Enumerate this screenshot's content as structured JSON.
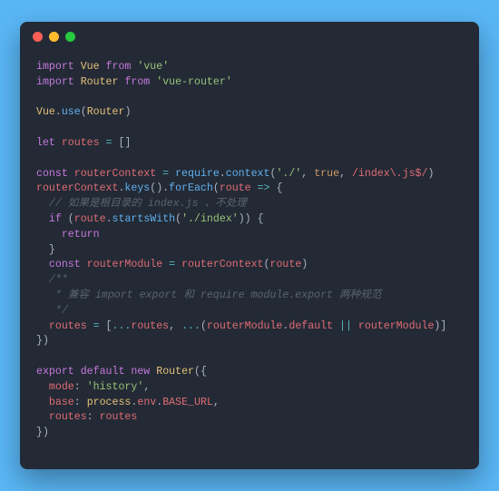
{
  "colors": {
    "background": "#59b6f5",
    "window": "#232a35",
    "dots": [
      "#ff5f56",
      "#ffbd2e",
      "#27c93f"
    ]
  },
  "tokens": {
    "kw_import1": "import",
    "type_Vue1": "Vue",
    "kw_from1": "from",
    "str_vue": "'vue'",
    "kw_import2": "import",
    "type_Router1": "Router",
    "kw_from2": "from",
    "str_vuerouter": "'vue-router'",
    "type_Vue2": "Vue",
    "punc_dot1": ".",
    "fn_use": "use",
    "punc_open1": "(",
    "type_Router2": "Router",
    "punc_close1": ")",
    "kw_let": "let",
    "var_routes1": "routes",
    "op_eq1": " = ",
    "punc_brackets": "[]",
    "kw_const1": "const",
    "var_routerContext1": "routerContext",
    "op_eq2": " = ",
    "fn_require": "require",
    "punc_dot2": ".",
    "fn_context": "context",
    "punc_open2": "(",
    "str_dotslash": "'./'",
    "punc_comma1": ", ",
    "bool_true": "true",
    "punc_comma2": ", ",
    "regex_index": "/index\\.js$/",
    "punc_close2": ")",
    "var_routerContext2": "routerContext",
    "punc_dot3": ".",
    "fn_keys": "keys",
    "punc_parens1": "().",
    "fn_forEach": "forEach",
    "punc_open3": "(",
    "var_route1": "route",
    "op_arrow": " => ",
    "punc_brace_open1": "{",
    "cmt_line1": "// 如果是根目录的 index.js 、不处理",
    "kw_if": "if",
    "punc_open4": " (",
    "var_route2": "route",
    "punc_dot4": ".",
    "fn_startsWith": "startsWith",
    "punc_open5": "(",
    "str_dotindex": "'./index'",
    "punc_close5": ")) ",
    "punc_brace_open2": "{",
    "kw_return": "return",
    "punc_brace_close1": "}",
    "kw_const2": "const",
    "var_routerModule1": "routerModule",
    "op_eq3": " = ",
    "var_routerContext3": "routerContext",
    "punc_open6": "(",
    "var_route3": "route",
    "punc_close6": ")",
    "cmt_block_open": "/**",
    "cmt_block_line": " * 兼容 import export 和 require module.export 两种规范",
    "cmt_block_close": " */",
    "var_routes2": "routes",
    "op_eq4": " = ",
    "punc_bracket_open": "[",
    "op_spread1": "...",
    "var_routes3": "routes",
    "punc_comma3": ", ",
    "op_spread2": "...",
    "punc_open7": "(",
    "var_routerModule2": "routerModule",
    "punc_dot5": ".",
    "prop_default": "default",
    "op_or": " || ",
    "var_routerModule3": "routerModule",
    "punc_close7": ")",
    "punc_bracket_close": "]",
    "punc_brace_close2": "})",
    "kw_export": "export",
    "kw_default": "default",
    "kw_new": "new",
    "type_Router3": "Router",
    "punc_open8": "(",
    "punc_brace_open3": "{",
    "prop_mode": "mode",
    "punc_colon1": ": ",
    "str_history": "'history'",
    "punc_comma4": ",",
    "prop_base": "base",
    "punc_colon2": ": ",
    "type_process": "process",
    "punc_dot6": ".",
    "prop_env": "env",
    "punc_dot7": ".",
    "prop_BASE_URL": "BASE_URL",
    "punc_comma5": ",",
    "prop_routes": "routes",
    "punc_colon3": ": ",
    "var_routes4": "routes",
    "punc_brace_close3": "})"
  }
}
